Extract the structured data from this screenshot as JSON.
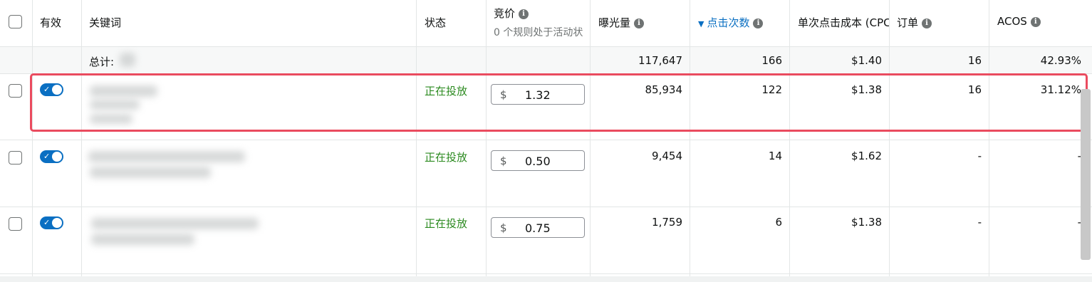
{
  "header": {
    "enabled": "有效",
    "keyword": "关键词",
    "status": "状态",
    "bid": "竞价",
    "bid_sub": "0 个规则处于活动状",
    "impressions": "曝光量",
    "clicks": "点击次数",
    "cpc": "单次点击成本 (CPC",
    "orders": "订单",
    "acos": "ACOS"
  },
  "total": {
    "label": "总计:",
    "impressions": "117,647",
    "clicks": "166",
    "cpc": "$1.40",
    "orders": "16",
    "acos": "42.93%"
  },
  "rows": [
    {
      "status": "正在投放",
      "currency": "$",
      "bid": "1.32",
      "impressions": "85,934",
      "clicks": "122",
      "cpc": "$1.38",
      "orders": "16",
      "acos": "31.12%"
    },
    {
      "status": "正在投放",
      "currency": "$",
      "bid": "0.50",
      "impressions": "9,454",
      "clicks": "14",
      "cpc": "$1.62",
      "orders": "-",
      "acos": "-"
    },
    {
      "status": "正在投放",
      "currency": "$",
      "bid": "0.75",
      "impressions": "1,759",
      "clicks": "6",
      "cpc": "$1.38",
      "orders": "-",
      "acos": "-"
    }
  ],
  "colors": {
    "accent": "#0a6fc2",
    "status": "#2b8a1f",
    "highlight": "#ea4b5f"
  },
  "icons": {
    "info": "info-circle-icon",
    "sort": "sort-down-icon",
    "toggle_check": "check-icon"
  }
}
